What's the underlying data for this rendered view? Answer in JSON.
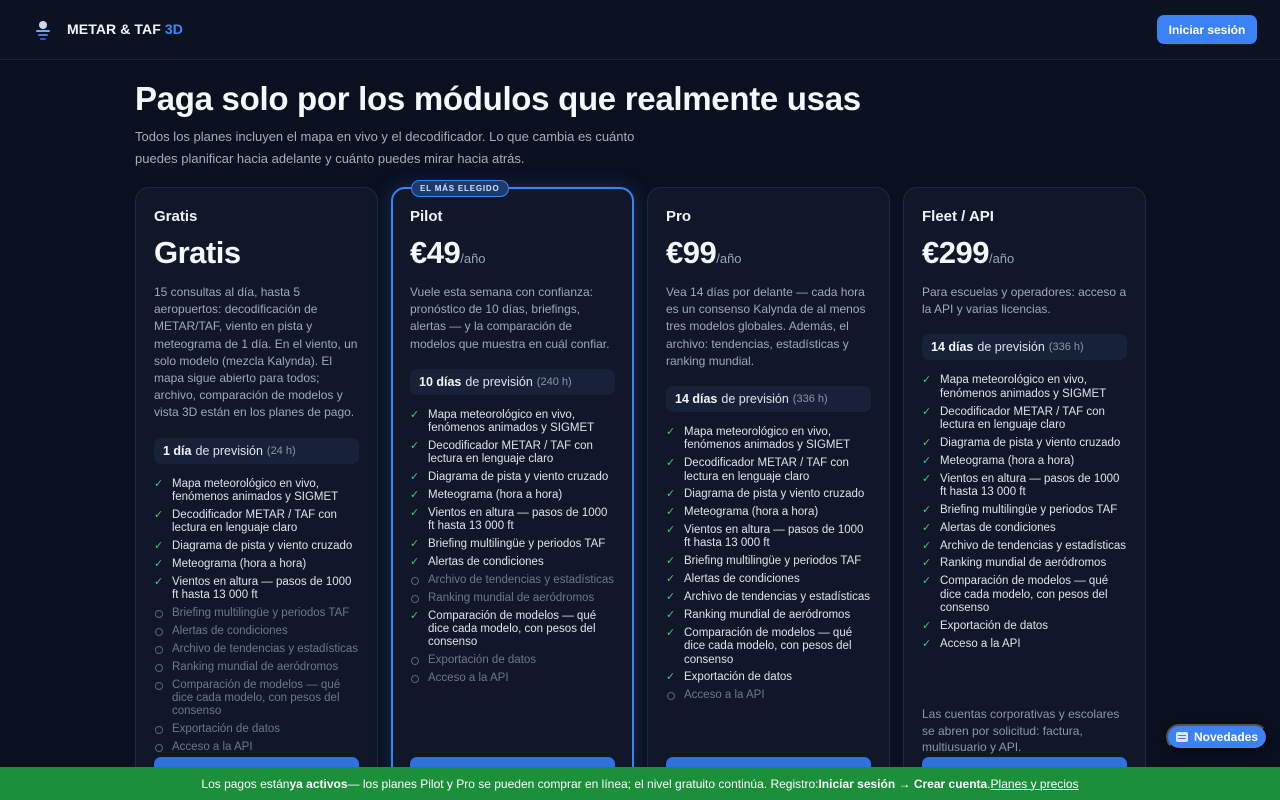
{
  "header": {
    "brand_main": "METAR & TAF",
    "brand_accent": "3D",
    "login_label": "Iniciar sesión"
  },
  "hero": {
    "title": "Paga solo por los módulos que realmente usas",
    "subtitle": "Todos los planes incluyen el mapa en vivo y el decodificador. Lo que cambia es cuánto puedes planificar hacia adelante y cuánto puedes mirar hacia atrás."
  },
  "plans": [
    {
      "name": "Gratis",
      "price": "Gratis",
      "unit": "",
      "desc": "15 consultas al día, hasta 5 aeropuertos: decodificación de METAR/TAF, viento en pista y meteograma de 1 día. En el viento, un solo modelo (mezcla Kalynda). El mapa sigue abierto para todos; archivo, comparación de modelos y vista 3D están en los planes de pago.",
      "forecast_bold": "1 día",
      "forecast_rest": "de previsión",
      "forecast_hours": "(24 h)",
      "features": [
        {
          "label": "Mapa meteorológico en vivo, fenómenos animados y SIGMET",
          "on": true
        },
        {
          "label": "Decodificador METAR / TAF con lectura en lenguaje claro",
          "on": true
        },
        {
          "label": "Diagrama de pista y viento cruzado",
          "on": true
        },
        {
          "label": "Meteograma (hora a hora)",
          "on": true
        },
        {
          "label": "Vientos en altura — pasos de 1000 ft hasta 13 000 ft",
          "on": true
        },
        {
          "label": "Briefing multilingüe y periodos TAF",
          "on": false
        },
        {
          "label": "Alertas de condiciones",
          "on": false
        },
        {
          "label": "Archivo de tendencias y estadísticas",
          "on": false
        },
        {
          "label": "Ranking mundial de aeródromos",
          "on": false
        },
        {
          "label": "Comparación de modelos — qué dice cada modelo, con pesos del consenso",
          "on": false
        },
        {
          "label": "Exportación de datos",
          "on": false
        },
        {
          "label": "Acceso a la API",
          "on": false
        }
      ]
    },
    {
      "name": "Pilot",
      "badge": "EL MÁS ELEGIDO",
      "price": "€49",
      "unit": "/año",
      "desc": "Vuele esta semana con confianza: pronóstico de 10 días, briefings, alertas — y la comparación de modelos que muestra en cuál confiar.",
      "forecast_bold": "10 días",
      "forecast_rest": "de previsión",
      "forecast_hours": "(240 h)",
      "features": [
        {
          "label": "Mapa meteorológico en vivo, fenómenos animados y SIGMET",
          "on": true
        },
        {
          "label": "Decodificador METAR / TAF con lectura en lenguaje claro",
          "on": true
        },
        {
          "label": "Diagrama de pista y viento cruzado",
          "on": true
        },
        {
          "label": "Meteograma (hora a hora)",
          "on": true
        },
        {
          "label": "Vientos en altura — pasos de 1000 ft hasta 13 000 ft",
          "on": true
        },
        {
          "label": "Briefing multilingüe y periodos TAF",
          "on": true
        },
        {
          "label": "Alertas de condiciones",
          "on": true
        },
        {
          "label": "Archivo de tendencias y estadísticas",
          "on": false
        },
        {
          "label": "Ranking mundial de aeródromos",
          "on": false
        },
        {
          "label": "Comparación de modelos — qué dice cada modelo, con pesos del consenso",
          "on": true
        },
        {
          "label": "Exportación de datos",
          "on": false
        },
        {
          "label": "Acceso a la API",
          "on": false
        }
      ]
    },
    {
      "name": "Pro",
      "price": "€99",
      "unit": "/año",
      "desc": "Vea 14 días por delante — cada hora es un consenso Kalynda de al menos tres modelos globales. Además, el archivo: tendencias, estadísticas y ranking mundial.",
      "forecast_bold": "14 días",
      "forecast_rest": "de previsión",
      "forecast_hours": "(336 h)",
      "features": [
        {
          "label": "Mapa meteorológico en vivo, fenómenos animados y SIGMET",
          "on": true
        },
        {
          "label": "Decodificador METAR / TAF con lectura en lenguaje claro",
          "on": true
        },
        {
          "label": "Diagrama de pista y viento cruzado",
          "on": true
        },
        {
          "label": "Meteograma (hora a hora)",
          "on": true
        },
        {
          "label": "Vientos en altura — pasos de 1000 ft hasta 13 000 ft",
          "on": true
        },
        {
          "label": "Briefing multilingüe y periodos TAF",
          "on": true
        },
        {
          "label": "Alertas de condiciones",
          "on": true
        },
        {
          "label": "Archivo de tendencias y estadísticas",
          "on": true
        },
        {
          "label": "Ranking mundial de aeródromos",
          "on": true
        },
        {
          "label": "Comparación de modelos — qué dice cada modelo, con pesos del consenso",
          "on": true
        },
        {
          "label": "Exportación de datos",
          "on": true
        },
        {
          "label": "Acceso a la API",
          "on": false
        }
      ]
    },
    {
      "name": "Fleet / API",
      "price": "€299",
      "unit": "/año",
      "desc": "Para escuelas y operadores: acceso a la API y varias licencias.",
      "forecast_bold": "14 días",
      "forecast_rest": "de previsión",
      "forecast_hours": "(336 h)",
      "corp_note": "Las cuentas corporativas y escolares se abren por solicitud: factura, multiusuario y API.",
      "features": [
        {
          "label": "Mapa meteorológico en vivo, fenómenos animados y SIGMET",
          "on": true
        },
        {
          "label": "Decodificador METAR / TAF con lectura en lenguaje claro",
          "on": true
        },
        {
          "label": "Diagrama de pista y viento cruzado",
          "on": true
        },
        {
          "label": "Meteograma (hora a hora)",
          "on": true
        },
        {
          "label": "Vientos en altura — pasos de 1000 ft hasta 13 000 ft",
          "on": true
        },
        {
          "label": "Briefing multilingüe y periodos TAF",
          "on": true
        },
        {
          "label": "Alertas de condiciones",
          "on": true
        },
        {
          "label": "Archivo de tendencias y estadísticas",
          "on": true
        },
        {
          "label": "Ranking mundial de aeródromos",
          "on": true
        },
        {
          "label": "Comparación de modelos — qué dice cada modelo, con pesos del consenso",
          "on": true
        },
        {
          "label": "Exportación de datos",
          "on": true
        },
        {
          "label": "Acceso a la API",
          "on": true
        }
      ]
    }
  ],
  "news_button": "Novedades",
  "banner": {
    "p1": "Los pagos están ",
    "b1": "ya activos",
    "p2": " — los planes Pilot y Pro se pueden comprar en línea; el nivel gratuito continúa. Registro: ",
    "b2": "Iniciar sesión → Crear cuenta",
    "p3": ". ",
    "link": "Planes y precios"
  },
  "colors": {
    "accent": "#3b82f6",
    "check": "#3fc67a",
    "banner": "#1b8f3a"
  }
}
